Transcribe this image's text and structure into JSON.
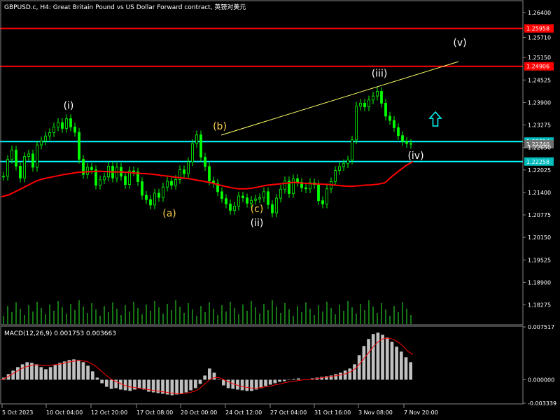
{
  "header": {
    "title": "GBPUSD.c, H4:  Great Britain Pound vs US Dollar Forward contract, 英镑对美元"
  },
  "macd_panel": {
    "label": "MACD(12,26,9) 0.001753 0.003663"
  },
  "colors": {
    "background": "#000000",
    "bull_candle": "#00ff00",
    "bear_candle": "#00ff00",
    "ma_line": "#ff0000",
    "resistance": "#ff0000",
    "support": "#00ffff",
    "trendline": "#ffff66",
    "label_wave": "#ffffff",
    "label_abc": "#ffd24a",
    "macd_hist": "#c0c0c0",
    "macd_signal": "#ff0000",
    "up_arrow": "#00ffff"
  },
  "chart_data": [
    {
      "type": "candlestick",
      "symbol": "GBPUSD.c",
      "timeframe": "H4",
      "ylim": [
        1.1774,
        1.2671
      ],
      "y_ticks": [
        "1.26400",
        "1.25710",
        "1.25150",
        "1.24525",
        "1.23900",
        "1.23275",
        "1.22650",
        "1.22025",
        "1.21400",
        "1.20775",
        "1.20150",
        "1.19525",
        "1.18900",
        "1.18275"
      ],
      "x_ticks": [
        "5 Oct 2023",
        "10 Oct 04:00",
        "12 Oct 20:00",
        "17 Oct 08:00",
        "20 Oct 00:00",
        "24 Oct 12:00",
        "27 Oct 04:00",
        "31 Oct 16:00",
        "3 Nov 08:00",
        "7 Nov 20:00"
      ],
      "horizontal_levels": [
        {
          "value": 1.25958,
          "label": "1.25958",
          "kind": "resistance"
        },
        {
          "value": 1.24906,
          "label": "1.24906",
          "kind": "resistance"
        },
        {
          "value": 1.22814,
          "label": "1.22814",
          "kind": "support"
        },
        {
          "value": 1.2274,
          "label": "1.22740",
          "kind": "current"
        },
        {
          "value": 1.22258,
          "label": "1.22258",
          "kind": "support"
        }
      ],
      "wave_labels": [
        {
          "text": "(i)",
          "price": 1.2372,
          "style": "wave"
        },
        {
          "text": "(a)",
          "price": 1.2073,
          "style": "abc"
        },
        {
          "text": "(b)",
          "price": 1.2315,
          "style": "abc"
        },
        {
          "text": "(c)",
          "price": 1.2085,
          "style": "abc"
        },
        {
          "text": "(ii)",
          "price": 1.2046,
          "style": "wave"
        },
        {
          "text": "(iii)",
          "price": 1.2462,
          "style": "wave"
        },
        {
          "text": "(iv)",
          "price": 1.2233,
          "style": "wave"
        },
        {
          "text": "(v)",
          "price": 1.2547,
          "style": "wave"
        }
      ],
      "close_series": [
        1.2185,
        1.2232,
        1.2258,
        1.2213,
        1.218,
        1.224,
        1.2247,
        1.221,
        1.2272,
        1.2283,
        1.2297,
        1.2306,
        1.2322,
        1.2334,
        1.2318,
        1.2345,
        1.2322,
        1.2307,
        1.2232,
        1.219,
        1.221,
        1.2203,
        1.216,
        1.2175,
        1.2183,
        1.2213,
        1.218,
        1.221,
        1.2185,
        1.2162,
        1.22,
        1.2197,
        1.217,
        1.2132,
        1.212,
        1.2105,
        1.2138,
        1.2126,
        1.2155,
        1.2171,
        1.216,
        1.2176,
        1.2203,
        1.2192,
        1.2225,
        1.2276,
        1.23,
        1.2238,
        1.2212,
        1.2172,
        1.2165,
        1.2142,
        1.2123,
        1.2108,
        1.209,
        1.2102,
        1.213,
        1.2125,
        1.211,
        1.2118,
        1.2122,
        1.2125,
        1.2142,
        1.2106,
        1.2083,
        1.2124,
        1.2149,
        1.2172,
        1.2137,
        1.2178,
        1.2168,
        1.2153,
        1.215,
        1.2167,
        1.2162,
        1.2117,
        1.2108,
        1.215,
        1.217,
        1.2201,
        1.2212,
        1.222,
        1.223,
        1.2286,
        1.238,
        1.2388,
        1.2378,
        1.2397,
        1.2408,
        1.2421,
        1.2388,
        1.2352,
        1.234,
        1.232,
        1.2298,
        1.2282,
        1.2276,
        1.2274
      ],
      "ma_series": [
        1.2128,
        1.2133,
        1.2142,
        1.2152,
        1.2162,
        1.2172,
        1.2178,
        1.2182,
        1.2186,
        1.219,
        1.2193,
        1.2196,
        1.2197,
        1.2198,
        1.2199,
        1.2198,
        1.2197,
        1.2197,
        1.2196,
        1.2194,
        1.2193,
        1.2192,
        1.219,
        1.2187,
        1.2185,
        1.2182,
        1.218,
        1.2178,
        1.2174,
        1.2171,
        1.2167,
        1.2162,
        1.2157,
        1.2153,
        1.215,
        1.215,
        1.2152,
        1.2156,
        1.216,
        1.2162,
        1.2164,
        1.2166,
        1.2168,
        1.2166,
        1.2165,
        1.2164,
        1.2163,
        1.2162,
        1.216,
        1.2158,
        1.2157,
        1.2158,
        1.216,
        1.2161,
        1.2163,
        1.2167,
        1.2185,
        1.22,
        1.2215,
        1.2226
      ]
    },
    {
      "type": "macd",
      "params": "12,26,9",
      "ylim": [
        -0.003339,
        0.007517
      ],
      "y_ticks": [
        "0.007517",
        "0.000000",
        "-0.003339"
      ],
      "histogram": [
        0.0003,
        0.0008,
        0.0013,
        0.0018,
        0.0022,
        0.0025,
        0.0024,
        0.0022,
        0.0018,
        0.0015,
        0.0018,
        0.0021,
        0.0024,
        0.0026,
        0.0028,
        0.0029,
        0.0028,
        0.0025,
        0.002,
        0.0012,
        0.0003,
        -0.0005,
        -0.001,
        -0.0013,
        -0.0012,
        -0.0014,
        -0.0015,
        -0.0016,
        -0.0014,
        -0.0012,
        -0.0014,
        -0.0017,
        -0.0018,
        -0.0019,
        -0.002,
        -0.0021,
        -0.0022,
        -0.0021,
        -0.002,
        -0.0018,
        -0.0015,
        -0.0012,
        -0.0006,
        0.0006,
        0.0016,
        0.001,
        0.0,
        -0.0008,
        -0.0012,
        -0.0013,
        -0.0014,
        -0.0015,
        -0.0016,
        -0.0016,
        -0.0014,
        -0.0012,
        -0.0009,
        -0.0007,
        -0.0005,
        -0.0003,
        -0.0002,
        0.0,
        0.0001,
        0.0002,
        0.0,
        0.0,
        0.0002,
        0.0003,
        0.0004,
        0.0005,
        0.0006,
        0.0008,
        0.001,
        0.0013,
        0.0016,
        0.0022,
        0.0035,
        0.0048,
        0.0058,
        0.0065,
        0.0067,
        0.0064,
        0.006,
        0.0054,
        0.0047,
        0.004,
        0.0032,
        0.0025
      ],
      "signal": [
        0.0,
        0.0003,
        0.0007,
        0.0011,
        0.0015,
        0.0018,
        0.002,
        0.0021,
        0.0021,
        0.002,
        0.002,
        0.0021,
        0.0022,
        0.0023,
        0.0025,
        0.0026,
        0.0027,
        0.0027,
        0.0026,
        0.0023,
        0.0019,
        0.0013,
        0.0007,
        0.0002,
        -0.0002,
        -0.0005,
        -0.0008,
        -0.001,
        -0.0011,
        -0.0012,
        -0.0013,
        -0.0014,
        -0.0015,
        -0.0016,
        -0.0017,
        -0.0018,
        -0.0019,
        -0.002,
        -0.002,
        -0.0019,
        -0.0018,
        -0.0016,
        -0.0012,
        -0.0006,
        0.0,
        0.0003,
        0.0003,
        0.0,
        -0.0003,
        -0.0006,
        -0.0008,
        -0.001,
        -0.0011,
        -0.0012,
        -0.0012,
        -0.0011,
        -0.001,
        -0.0009,
        -0.0007,
        -0.0006,
        -0.0004,
        -0.0003,
        -0.0002,
        -0.0001,
        0.0,
        0.0,
        0.0001,
        0.0002,
        0.0003,
        0.0004,
        0.0005,
        0.0006,
        0.0007,
        0.0009,
        0.0012,
        0.0017,
        0.0025,
        0.0033,
        0.0042,
        0.005,
        0.0056,
        0.0059,
        0.0059,
        0.0057,
        0.0053,
        0.0047,
        0.004,
        0.0036
      ]
    }
  ]
}
